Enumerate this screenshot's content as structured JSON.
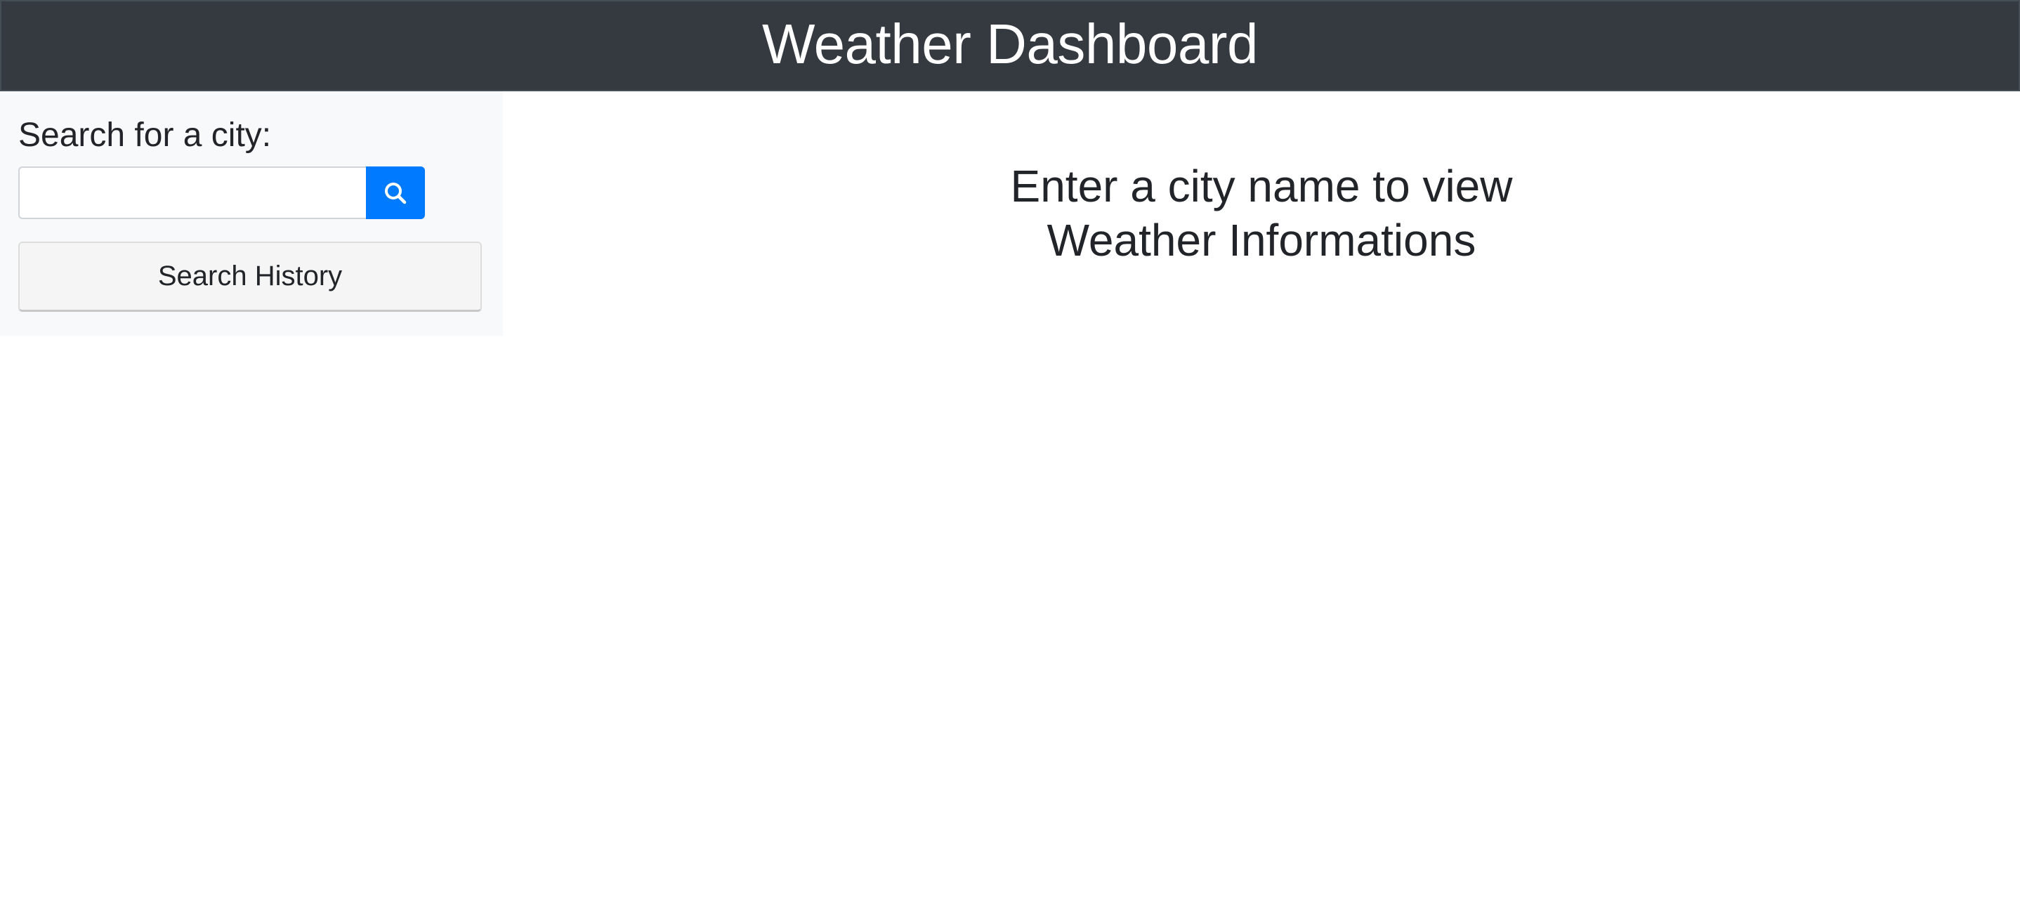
{
  "header": {
    "title": "Weather Dashboard"
  },
  "sidebar": {
    "search_label": "Search for a city:",
    "search_input": {
      "value": "",
      "placeholder": ""
    },
    "search_button_icon": "search-icon",
    "history_button_label": "Search History"
  },
  "main": {
    "prompt_line1": "Enter a city name to view",
    "prompt_line2": "Weather Informations"
  },
  "colors": {
    "header_bg": "#343a40",
    "sidebar_bg": "#f8f9fa",
    "accent": "#007bff",
    "text": "#212529"
  }
}
